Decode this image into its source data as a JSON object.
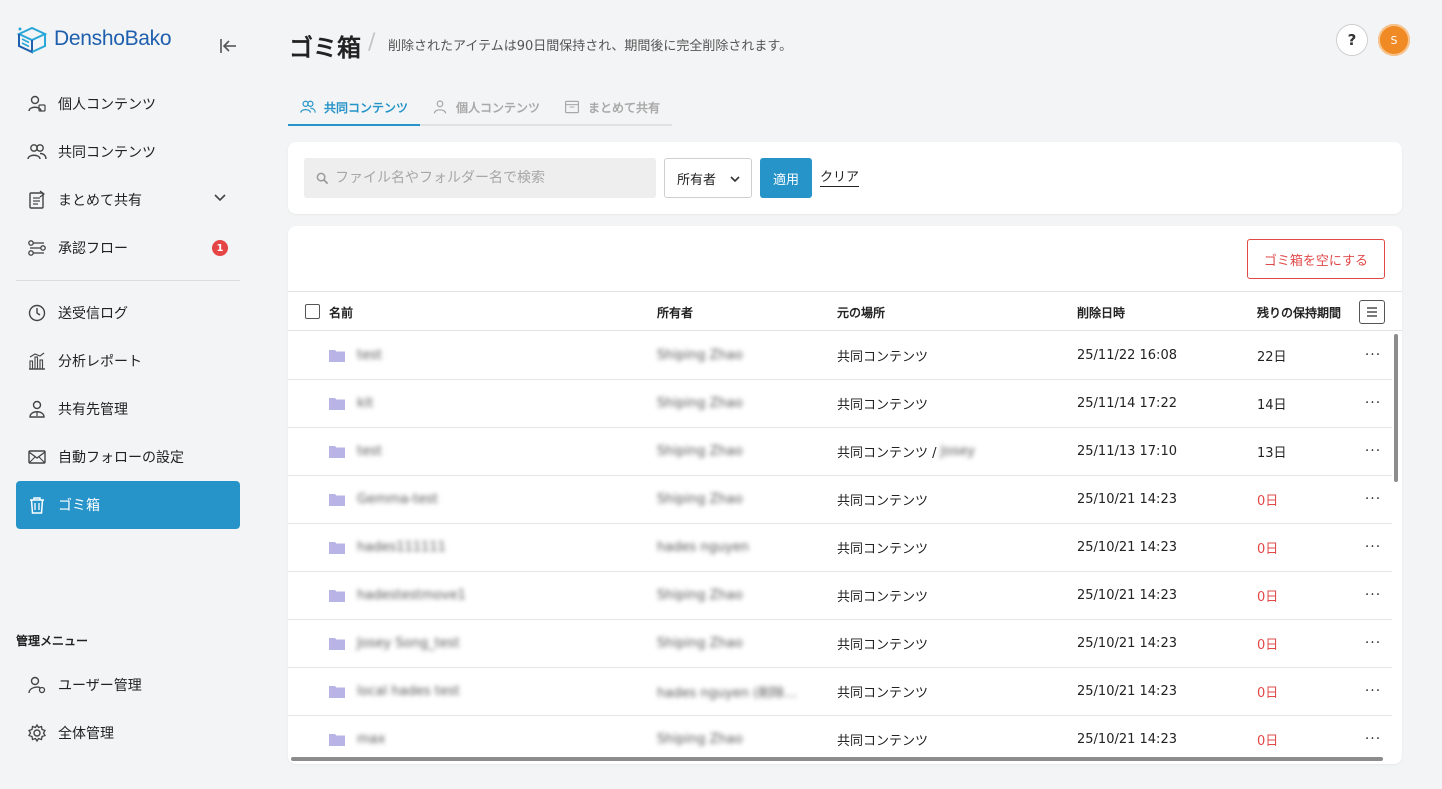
{
  "app": {
    "name": "DenshoBako"
  },
  "sidebar": {
    "items": [
      {
        "label": "個人コンテンツ",
        "icon": "person-icon"
      },
      {
        "label": "共同コンテンツ",
        "icon": "users-icon"
      },
      {
        "label": "まとめて共有",
        "icon": "document-share-icon"
      },
      {
        "label": "承認フロー",
        "icon": "flow-icon",
        "badge": "1"
      },
      {
        "label": "送受信ログ",
        "icon": "clock-icon"
      },
      {
        "label": "分析レポート",
        "icon": "bar-chart-icon"
      },
      {
        "label": "共有先管理",
        "icon": "contacts-icon"
      },
      {
        "label": "自動フォローの設定",
        "icon": "mail-icon"
      },
      {
        "label": "ゴミ箱",
        "icon": "trash-icon",
        "active": true
      }
    ],
    "admin_section_label": "管理メニュー",
    "admin_items": [
      {
        "label": "ユーザー管理",
        "icon": "user-settings-icon"
      },
      {
        "label": "全体管理",
        "icon": "gear-icon"
      }
    ]
  },
  "header": {
    "title": "ゴミ箱",
    "separator": "/",
    "subtitle": "削除されたアイテムは90日間保持され、期間後に完全削除されます。",
    "help_label": "?",
    "avatar_initial": "S"
  },
  "tabs": [
    {
      "label": "共同コンテンツ",
      "active": true
    },
    {
      "label": "個人コンテンツ",
      "active": false
    },
    {
      "label": "まとめて共有",
      "active": false
    }
  ],
  "filter": {
    "search_placeholder": "ファイル名やフォルダー名で検索",
    "owner_select_value": "所有者",
    "apply_label": "適用",
    "clear_label": "クリア"
  },
  "table": {
    "empty_trash_label": "ゴミ箱を空にする",
    "columns": {
      "name": "名前",
      "owner": "所有者",
      "location": "元の場所",
      "deleted_at": "削除日時",
      "retention": "残りの保持期間"
    },
    "rows": [
      {
        "name": "test",
        "owner": "Shiping Zhao",
        "location": "共同コンテンツ",
        "location_sub": "",
        "deleted_at": "25/11/22 16:08",
        "retention": "22日"
      },
      {
        "name": "kit",
        "owner": "Shiping Zhao",
        "location": "共同コンテンツ",
        "location_sub": "",
        "deleted_at": "25/11/14 17:22",
        "retention": "14日"
      },
      {
        "name": "test",
        "owner": "Shiping Zhao",
        "location": "共同コンテンツ / ",
        "location_sub": "Josey",
        "deleted_at": "25/11/13 17:10",
        "retention": "13日"
      },
      {
        "name": "Gemma-test",
        "owner": "Shiping Zhao",
        "location": "共同コンテンツ",
        "location_sub": "",
        "deleted_at": "25/10/21 14:23",
        "retention": "0日"
      },
      {
        "name": "hades111111",
        "owner": "hades nguyen",
        "location": "共同コンテンツ",
        "location_sub": "",
        "deleted_at": "25/10/21 14:23",
        "retention": "0日"
      },
      {
        "name": "hadestestmove1",
        "owner": "Shiping Zhao",
        "location": "共同コンテンツ",
        "location_sub": "",
        "deleted_at": "25/10/21 14:23",
        "retention": "0日"
      },
      {
        "name": "Josey Song_test",
        "owner": "Shiping Zhao",
        "location": "共同コンテンツ",
        "location_sub": "",
        "deleted_at": "25/10/21 14:23",
        "retention": "0日"
      },
      {
        "name": "local hades test",
        "owner": "hades nguyen (削除…",
        "location": "共同コンテンツ",
        "location_sub": "",
        "deleted_at": "25/10/21 14:23",
        "retention": "0日"
      },
      {
        "name": "max",
        "owner": "Shiping Zhao",
        "location": "共同コンテンツ",
        "location_sub": "",
        "deleted_at": "25/10/21 14:23",
        "retention": "0日"
      }
    ]
  },
  "colors": {
    "accent": "#2694c9",
    "danger": "#e04848",
    "logo": "#1e5fae",
    "folder": "#b9b4e6",
    "avatar": "#f08a24"
  }
}
